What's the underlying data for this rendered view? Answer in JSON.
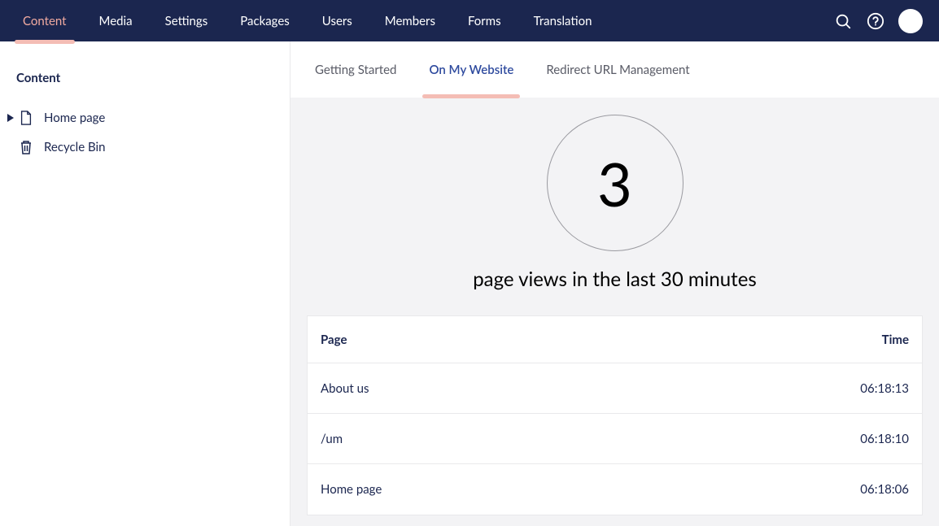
{
  "topnav": {
    "items": [
      {
        "label": "Content",
        "active": true
      },
      {
        "label": "Media"
      },
      {
        "label": "Settings"
      },
      {
        "label": "Packages"
      },
      {
        "label": "Users"
      },
      {
        "label": "Members"
      },
      {
        "label": "Forms"
      },
      {
        "label": "Translation"
      }
    ]
  },
  "sidebar": {
    "title": "Content",
    "tree": [
      {
        "label": "Home page",
        "icon": "document",
        "hasChildren": true
      },
      {
        "label": "Recycle Bin",
        "icon": "trash",
        "hasChildren": false
      }
    ]
  },
  "subnav": {
    "items": [
      {
        "label": "Getting Started"
      },
      {
        "label": "On My Website",
        "active": true
      },
      {
        "label": "Redirect URL Management"
      }
    ]
  },
  "stat": {
    "value": "3",
    "caption": "page views in the last 30 minutes"
  },
  "table": {
    "headers": {
      "page": "Page",
      "time": "Time"
    },
    "rows": [
      {
        "page": "About us",
        "time": "06:18:13"
      },
      {
        "page": "/um",
        "time": "06:18:10"
      },
      {
        "page": "Home page",
        "time": "06:18:06"
      }
    ]
  }
}
